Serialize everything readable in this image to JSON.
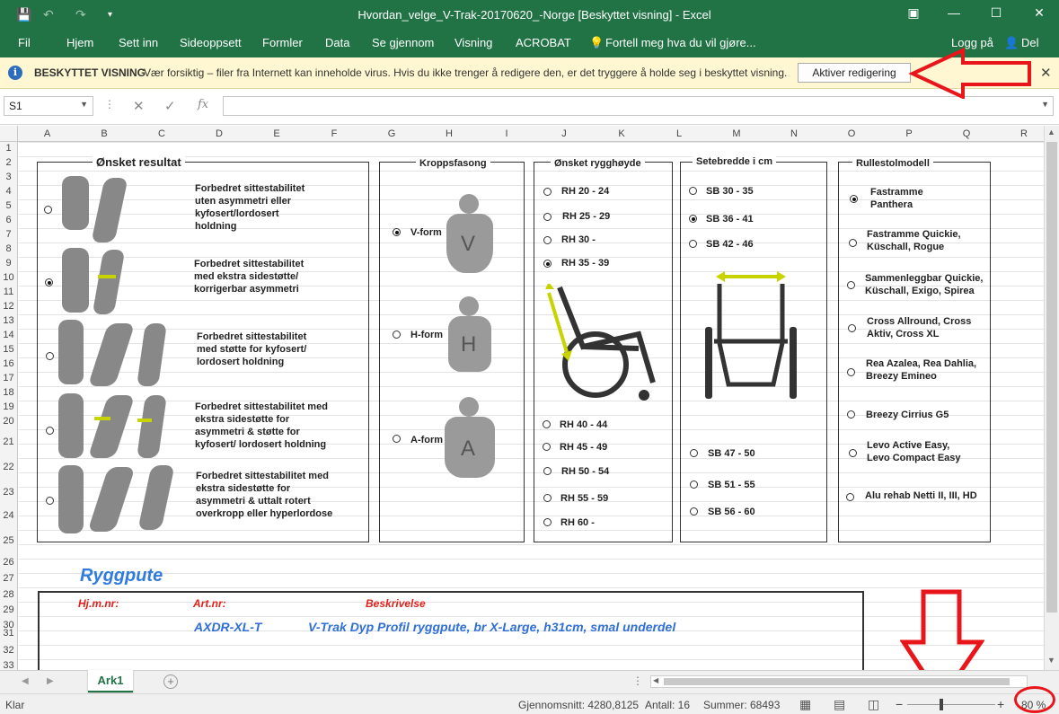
{
  "titlebar": {
    "title": "Hvordan_velge_V-Trak-20170620_-Norge  [Beskyttet visning] - Excel"
  },
  "ribbon": {
    "tabs": [
      "Fil",
      "Hjem",
      "Sett inn",
      "Sideoppsett",
      "Formler",
      "Data",
      "Se gjennom",
      "Visning",
      "ACROBAT",
      "Fortell meg hva du vil gjøre..."
    ],
    "login": "Logg på",
    "share": "Del"
  },
  "protected": {
    "label": "BESKYTTET VISNING",
    "message": "Vær forsiktig – filer fra Internett kan inneholde virus. Hvis du ikke trenger å redigere den, er det tryggere å holde seg i beskyttet visning.",
    "enable_button": "Aktiver redigering"
  },
  "formula": {
    "namebox": "S1",
    "fx": "fx",
    "value": ""
  },
  "columns": [
    "A",
    "B",
    "C",
    "D",
    "E",
    "F",
    "G",
    "H",
    "I",
    "J",
    "K",
    "L",
    "M",
    "N",
    "O",
    "P",
    "Q",
    "R"
  ],
  "rows": [
    "1",
    "2",
    "3",
    "4",
    "5",
    "6",
    "7",
    "8",
    "9",
    "10",
    "11",
    "12",
    "13",
    "14",
    "15",
    "16",
    "17",
    "18",
    "19",
    "20",
    "21",
    "22",
    "23",
    "24",
    "25",
    "26",
    "27",
    "28",
    "29",
    "30",
    "31",
    "32",
    "33"
  ],
  "sections": {
    "result": {
      "title": "Ønsket resultat",
      "options": [
        {
          "text": "Forbedret sittestabilitet\nuten asymmetri eller\nkyfosert/lordosert\nholdning",
          "selected": false
        },
        {
          "text": "Forbedret sittestabilitet\nmed ekstra sidestøtte/\nkorrigerbar asymmetri",
          "selected": true
        },
        {
          "text": "Forbedret sittestabilitet\nmed støtte for kyfosert/\nlordosert holdning",
          "selected": false
        },
        {
          "text": "Forbedret sittestabilitet med\nekstra sidestøtte for\nasymmetri & støtte for\nkyfosert/ lordosert holdning",
          "selected": false
        },
        {
          "text": "Forbedret sittestabilitet med\nekstra sidestøtte for\nasymmetri & uttalt rotert\noverkropp eller hyperlordose",
          "selected": false
        }
      ]
    },
    "body": {
      "title": "Kroppsfasong",
      "options": [
        {
          "text": "V-form",
          "letter": "V",
          "selected": true
        },
        {
          "text": "H-form",
          "letter": "H",
          "selected": false
        },
        {
          "text": "A-form",
          "letter": "A",
          "selected": false
        }
      ]
    },
    "height": {
      "title": "Ønsket rygghøyde",
      "options": [
        {
          "text": "RH 20 - 24",
          "selected": false
        },
        {
          "text": "RH 25 - 29",
          "selected": false
        },
        {
          "text": "RH 30 -",
          "selected": false
        },
        {
          "text": "RH 35 - 39",
          "selected": true
        },
        {
          "text": "RH 40 - 44",
          "selected": false
        },
        {
          "text": "RH 45 - 49",
          "selected": false
        },
        {
          "text": "RH 50 - 54",
          "selected": false
        },
        {
          "text": "RH 55 - 59",
          "selected": false
        },
        {
          "text": "RH 60 -",
          "selected": false
        }
      ]
    },
    "width": {
      "title": "Setebredde i cm",
      "options": [
        {
          "text": "SB 30 - 35",
          "selected": false
        },
        {
          "text": "SB 36 - 41",
          "selected": true
        },
        {
          "text": "SB 42 - 46",
          "selected": false
        },
        {
          "text": "SB 47 - 50",
          "selected": false
        },
        {
          "text": "SB 51 - 55",
          "selected": false
        },
        {
          "text": "SB 56 - 60",
          "selected": false
        }
      ]
    },
    "chair": {
      "title": "Rullestolmodell",
      "options": [
        {
          "text": "Fastramme\nPanthera",
          "selected": true
        },
        {
          "text": "Fastramme Quickie,\nKüschall, Rogue",
          "selected": false
        },
        {
          "text": "Sammenleggbar Quickie,\nKüschall, Exigo, Spirea",
          "selected": false
        },
        {
          "text": "Cross Allround, Cross\nAktiv, Cross XL",
          "selected": false
        },
        {
          "text": "Rea Azalea, Rea Dahlia,\nBreezy Emineo",
          "selected": false
        },
        {
          "text": "Breezy Cirrius G5",
          "selected": false
        },
        {
          "text": "Levo Active Easy,\nLevo Compact Easy",
          "selected": false
        },
        {
          "text": "Alu rehab Netti II, III, HD",
          "selected": false
        }
      ]
    }
  },
  "cushion": {
    "heading": "Ryggpute",
    "label_hjm": "Hj.m.nr:",
    "label_art": "Art.nr:",
    "label_desc": "Beskrivelse",
    "art_value": "AXDR-XL-T",
    "desc_value": "V-Trak Dyp Profil ryggpute, br X-Large, h31cm, smal underdel"
  },
  "tabs": {
    "sheet": "Ark1"
  },
  "status": {
    "ready": "Klar",
    "average": "Gjennomsnitt: 4280,8125",
    "count": "Antall: 16",
    "sum": "Summer: 68493",
    "zoom": "80 %"
  },
  "colors": {
    "excel_green": "#217346",
    "annotation_red": "#e8161b",
    "heading_blue": "#2f7be0"
  }
}
